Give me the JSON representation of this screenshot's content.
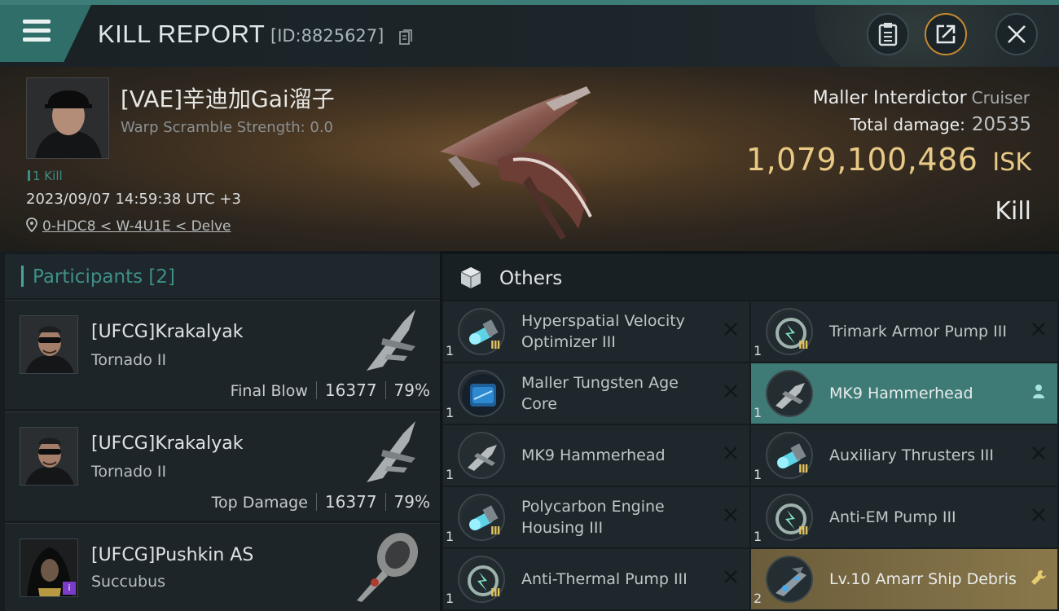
{
  "header": {
    "title": "KILL REPORT",
    "report_id": "[ID:8825627]"
  },
  "victim": {
    "name": "[VAE]辛迪加Gai溜子",
    "warp_scramble": "Warp Scramble Strength: 0.0",
    "kills": "1 Kill",
    "datetime": "2023/09/07 14:59:38 UTC +3",
    "location": "0-HDC8 < W-4U1E < Delve",
    "ship": "Maller Interdictor",
    "ship_class": "Cruiser",
    "total_damage_label": "Total damage:",
    "total_damage": "20535",
    "isk_value": "1,079,100,486",
    "isk_unit": "ISK",
    "result": "Kill"
  },
  "participants": {
    "label": "Participants",
    "count": "[2]",
    "items": [
      {
        "name": "[UFCG]Krakalyak",
        "ship": "Tornado II",
        "stat_label": "Final Blow",
        "damage": "16377",
        "percent": "79%"
      },
      {
        "name": "[UFCG]Krakalyak",
        "ship": "Tornado II",
        "stat_label": "Top Damage",
        "damage": "16377",
        "percent": "79%"
      },
      {
        "name": "[UFCG]Pushkin AS",
        "ship": "Succubus"
      }
    ]
  },
  "others": {
    "title": "Others",
    "items": [
      {
        "name": "Hyperspatial Velocity Optimizer III",
        "qty": "1",
        "icon": "rig-blue-icon",
        "tier": "III",
        "status": "destroyed"
      },
      {
        "name": "Trimark Armor Pump III",
        "qty": "1",
        "icon": "rig-green-icon",
        "tier": "III",
        "status": "destroyed"
      },
      {
        "name": "Maller Tungsten Age Core",
        "qty": "1",
        "icon": "core-blue-icon",
        "tier": "",
        "status": "destroyed"
      },
      {
        "name": "MK9  Hammerhead",
        "qty": "1",
        "icon": "drone-icon",
        "tier": "",
        "status": "dropped-active"
      },
      {
        "name": "MK9  Hammerhead",
        "qty": "1",
        "icon": "drone-icon",
        "tier": "",
        "status": "destroyed"
      },
      {
        "name": "Auxiliary Thrusters III",
        "qty": "1",
        "icon": "rig-blue-icon",
        "tier": "III",
        "status": "destroyed"
      },
      {
        "name": "Polycarbon Engine Housing III",
        "qty": "1",
        "icon": "rig-blue-icon",
        "tier": "III",
        "status": "destroyed"
      },
      {
        "name": "Anti-EM Pump III",
        "qty": "1",
        "icon": "rig-green-icon",
        "tier": "III",
        "status": "destroyed"
      },
      {
        "name": "Anti-Thermal Pump III",
        "qty": "1",
        "icon": "rig-green-icon",
        "tier": "III",
        "status": "destroyed"
      },
      {
        "name": "Lv.10 Amarr Ship Debris",
        "qty": "2",
        "icon": "debris-icon",
        "tier": "",
        "status": "dropped-gold"
      }
    ]
  },
  "colors": {
    "accent_teal": "#3e7a76",
    "isk_gold": "#e8c985",
    "tier_gold": "#e3c25e"
  }
}
